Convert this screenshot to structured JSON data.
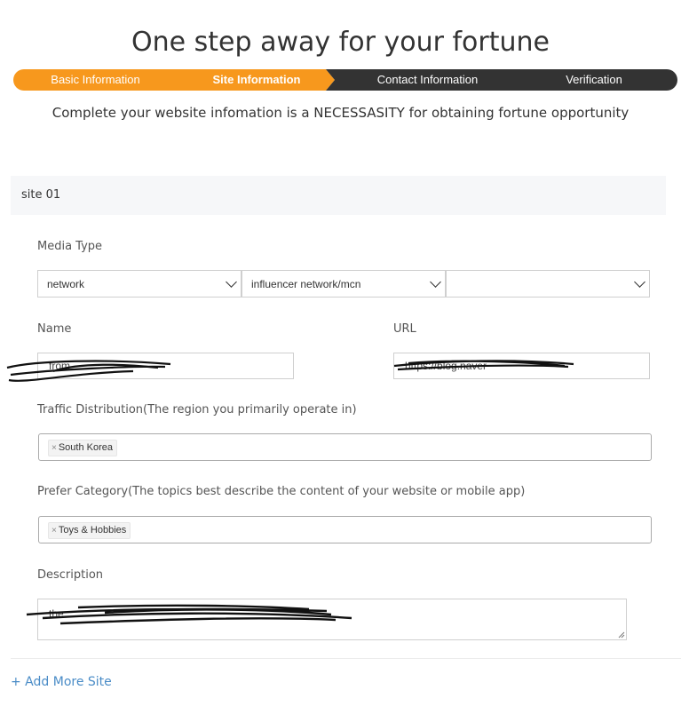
{
  "page": {
    "title": "One step away for your fortune",
    "subtitle": "Complete your website infomation is a NECESSASITY for obtaining fortune opportunity"
  },
  "steps": [
    {
      "label": "Basic Information",
      "state": "done"
    },
    {
      "label": "Site Information",
      "state": "active"
    },
    {
      "label": "Contact Information",
      "state": "todo"
    },
    {
      "label": "Verification",
      "state": "todo"
    }
  ],
  "colors": {
    "accent": "#f7981d",
    "step_dark": "#333333",
    "link": "#4a8cc7"
  },
  "site": {
    "header": "site 01",
    "media_type": {
      "label": "Media Type",
      "select1": "network",
      "select2": "influencer network/mcn",
      "select3": ""
    },
    "name": {
      "label": "Name",
      "value": "from"
    },
    "url": {
      "label": "URL",
      "value": "https://blog.naver"
    },
    "traffic": {
      "label": "Traffic Distribution(The region you primarily operate in)",
      "tag": "South Korea",
      "remove": "×"
    },
    "category": {
      "label": "Prefer Category(The topics best describe the content of your website or mobile app)",
      "tag": "Toys & Hobbies",
      "remove": "×"
    },
    "description": {
      "label": "Description",
      "value": "the"
    }
  },
  "add_more": "+ Add More Site",
  "icons": {
    "select_arrow": "chevron-down-icon",
    "tag_remove": "close-icon",
    "textarea_resize": "resize-grip-icon"
  }
}
